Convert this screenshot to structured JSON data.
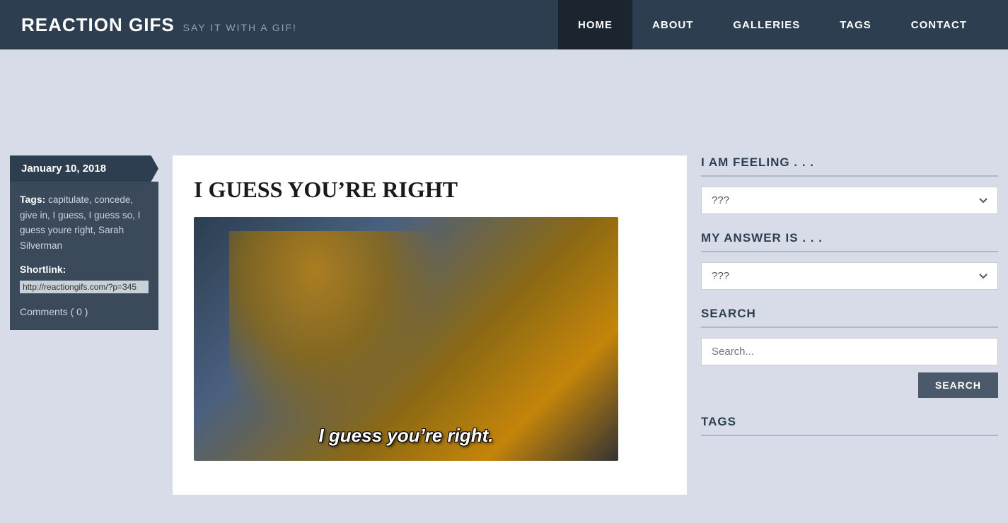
{
  "header": {
    "logo": "REACTION GIFS",
    "tagline": "SAY IT WITH A GIF!",
    "nav": [
      {
        "label": "HOME",
        "active": true
      },
      {
        "label": "ABOUT",
        "active": false
      },
      {
        "label": "GALLERIES",
        "active": false
      },
      {
        "label": "TAGS",
        "active": false
      },
      {
        "label": "CONTACT",
        "active": false
      }
    ]
  },
  "sidebar_left": {
    "date": "January 10, 2018",
    "tags_label": "Tags:",
    "tags": "capitulate, concede, give in, I guess, I guess so, I guess youre right, Sarah Silverman",
    "shortlink_label": "Shortlink:",
    "shortlink_value": "http://reactiongifs.com/?p=345",
    "comments": "Comments ( 0 )"
  },
  "post": {
    "title": "I GUESS YOU’RE RIGHT",
    "caption": "I guess you’re right."
  },
  "sidebar_right": {
    "feeling_title": "I AM FEELING . . .",
    "feeling_placeholder": "???",
    "answer_title": "MY ANSWER IS . . .",
    "answer_placeholder": "???",
    "search_title": "SEARCH",
    "search_placeholder": "Search...",
    "search_button": "SEARCH",
    "tags_title": "TAGS"
  }
}
